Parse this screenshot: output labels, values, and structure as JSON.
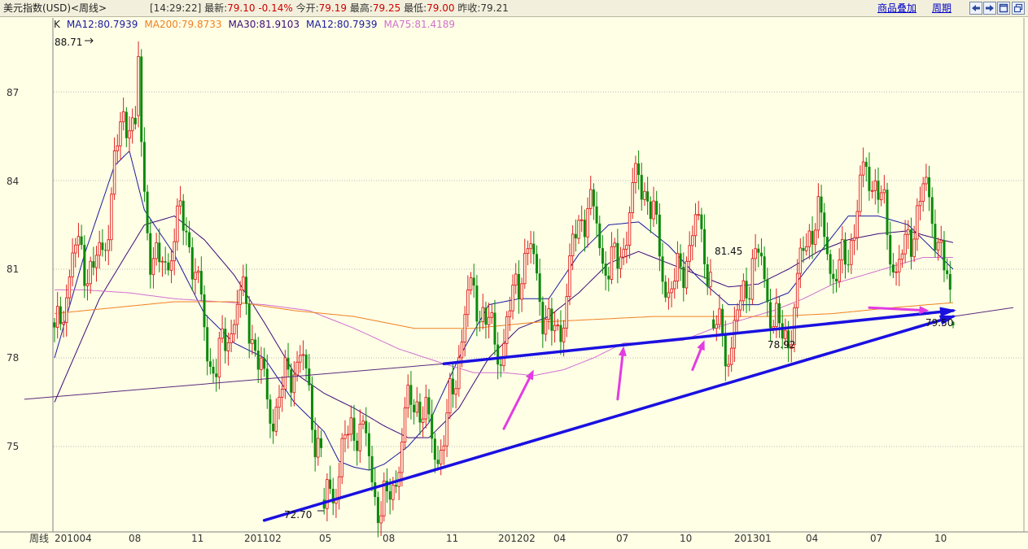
{
  "header": {
    "symbol": "美元指数(USD)<周线>",
    "time": "[14:29:22]",
    "latest_label": "最新:",
    "latest_value": "79.10",
    "change": "-0.14%",
    "open_label": "今开:",
    "open_value": "79.19",
    "high_label": "最高:",
    "high_value": "79.25",
    "low_label": "最低:",
    "low_value": "79.00",
    "prev_close_label": "昨收:",
    "prev_close_value": "79.21",
    "overlay_link": "商品叠加",
    "period_link": "周期",
    "buttons": [
      "back-icon",
      "forward-icon",
      "restore-icon",
      "maximize-icon"
    ]
  },
  "legend": {
    "k_label": "K",
    "items": [
      {
        "text": "MA12:80.7939",
        "color": "#1a1aa0"
      },
      {
        "text": "MA200:79.8733",
        "color": "#f08020"
      },
      {
        "text": "MA30:81.9103",
        "color": "#3c0a78"
      },
      {
        "text": "MA12:80.7939",
        "color": "#1a1aa0"
      },
      {
        "text": "MA75:81.4189",
        "color": "#d070d0"
      }
    ]
  },
  "chart_data": {
    "type": "candlestick",
    "period": "weekly",
    "y_ticks": [
      87,
      84,
      81,
      78,
      75
    ],
    "ylim": [
      71.7,
      89.5
    ],
    "x_label_corner": "周线",
    "x_ticks": [
      "201004",
      "08",
      "11",
      "201102",
      "05",
      "08",
      "11",
      "201202",
      "04",
      "07",
      "10",
      "201301",
      "04",
      "07",
      "10"
    ],
    "annotations": [
      "88.71",
      "72.70",
      "81.45",
      "78.92",
      "79.50"
    ],
    "colors": {
      "up": "#e02020",
      "down": "#0a8a0a",
      "trendline": "#1a10e0",
      "arrow": "#e23de0",
      "grid": "#b8b8b8"
    },
    "series": [
      {
        "name": "MA12",
        "color": "#1a1aa0",
        "points": [
          [
            0,
            78.0
          ],
          [
            10,
            81.5
          ],
          [
            20,
            84.5
          ],
          [
            25,
            85.0
          ],
          [
            30,
            83.0
          ],
          [
            40,
            81.5
          ],
          [
            50,
            79.5
          ],
          [
            60,
            78.5
          ],
          [
            70,
            78.0
          ],
          [
            80,
            76.5
          ],
          [
            90,
            75.5
          ],
          [
            95,
            74.5
          ],
          [
            100,
            74.3
          ],
          [
            105,
            74.2
          ],
          [
            110,
            74.4
          ],
          [
            118,
            75.0
          ],
          [
            125,
            75.8
          ],
          [
            135,
            78.0
          ],
          [
            145,
            79.8
          ],
          [
            155,
            80.0
          ],
          [
            165,
            80.0
          ],
          [
            175,
            81.5
          ],
          [
            185,
            82.5
          ],
          [
            195,
            82.6
          ],
          [
            205,
            81.8
          ],
          [
            215,
            80.7
          ],
          [
            225,
            79.8
          ],
          [
            235,
            79.8
          ],
          [
            245,
            80.2
          ],
          [
            255,
            81.5
          ],
          [
            265,
            82.8
          ],
          [
            275,
            82.8
          ],
          [
            285,
            82.5
          ],
          [
            292,
            81.8
          ],
          [
            300,
            81.0
          ]
        ]
      },
      {
        "name": "MA30",
        "color": "#3c0a78",
        "points": [
          [
            0,
            76.5
          ],
          [
            15,
            80.0
          ],
          [
            30,
            82.5
          ],
          [
            40,
            82.8
          ],
          [
            50,
            82.0
          ],
          [
            60,
            80.8
          ],
          [
            70,
            79.2
          ],
          [
            80,
            77.5
          ],
          [
            90,
            76.8
          ],
          [
            100,
            76.3
          ],
          [
            110,
            75.7
          ],
          [
            118,
            75.3
          ],
          [
            125,
            75.3
          ],
          [
            135,
            76.3
          ],
          [
            145,
            78.0
          ],
          [
            155,
            79.0
          ],
          [
            165,
            79.4
          ],
          [
            175,
            80.2
          ],
          [
            185,
            81.2
          ],
          [
            195,
            81.6
          ],
          [
            205,
            81.2
          ],
          [
            215,
            80.8
          ],
          [
            225,
            80.4
          ],
          [
            235,
            80.5
          ],
          [
            245,
            81.0
          ],
          [
            255,
            81.6
          ],
          [
            265,
            82.0
          ],
          [
            275,
            82.2
          ],
          [
            285,
            82.3
          ],
          [
            292,
            82.1
          ],
          [
            300,
            81.9
          ]
        ]
      },
      {
        "name": "MA75",
        "color": "#d070d0",
        "points": [
          [
            0,
            80.3
          ],
          [
            10,
            80.3
          ],
          [
            25,
            80.2
          ],
          [
            40,
            80.0
          ],
          [
            55,
            79.9
          ],
          [
            70,
            79.8
          ],
          [
            85,
            79.6
          ],
          [
            100,
            79.0
          ],
          [
            115,
            78.3
          ],
          [
            130,
            77.8
          ],
          [
            140,
            77.5
          ],
          [
            150,
            77.5
          ],
          [
            160,
            77.4
          ],
          [
            170,
            77.6
          ],
          [
            180,
            78.0
          ],
          [
            190,
            78.5
          ],
          [
            200,
            78.5
          ],
          [
            210,
            78.6
          ],
          [
            220,
            79.0
          ],
          [
            230,
            79.3
          ],
          [
            240,
            79.6
          ],
          [
            250,
            80.0
          ],
          [
            260,
            80.5
          ],
          [
            270,
            80.8
          ],
          [
            280,
            81.1
          ],
          [
            290,
            81.4
          ],
          [
            300,
            81.4
          ]
        ]
      },
      {
        "name": "MA200",
        "color": "#f08020",
        "points": [
          [
            0,
            79.5
          ],
          [
            20,
            79.7
          ],
          [
            40,
            79.9
          ],
          [
            60,
            79.9
          ],
          [
            80,
            79.6
          ],
          [
            100,
            79.4
          ],
          [
            120,
            79.0
          ],
          [
            140,
            79.0
          ],
          [
            160,
            79.2
          ],
          [
            180,
            79.3
          ],
          [
            200,
            79.4
          ],
          [
            220,
            79.4
          ],
          [
            240,
            79.4
          ],
          [
            260,
            79.5
          ],
          [
            280,
            79.7
          ],
          [
            300,
            79.87
          ]
        ]
      }
    ],
    "trendlines": [
      {
        "from": [
          -10,
          76.6
        ],
        "to": [
          130,
          77.8
        ]
      },
      {
        "from": [
          130,
          77.8
        ],
        "to": [
          300,
          79.6
        ]
      },
      {
        "from": [
          70,
          72.5
        ],
        "to": [
          300,
          79.4
        ]
      },
      {
        "from": [
          300,
          79.4
        ],
        "to": [
          320,
          79.7
        ]
      }
    ],
    "arrows": [
      {
        "from": [
          150,
          75.6
        ],
        "to": [
          160,
          77.6
        ]
      },
      {
        "from": [
          188,
          76.6
        ],
        "to": [
          190,
          78.4
        ]
      },
      {
        "from": [
          213,
          77.6
        ],
        "to": [
          217,
          78.6
        ]
      },
      {
        "from": [
          272,
          79.7
        ],
        "to": [
          292,
          79.6
        ]
      }
    ]
  }
}
